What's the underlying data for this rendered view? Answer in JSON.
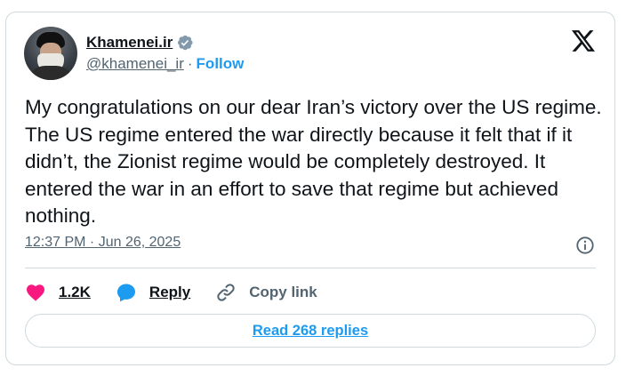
{
  "colors": {
    "accent": "#1d9bf0",
    "text_primary": "#0f1419",
    "text_secondary": "#536471",
    "border": "#cfd9de",
    "like": "#f91880"
  },
  "author": {
    "display_name": "Khamenei.ir",
    "handle": "@khamenei_ir",
    "separator": "·",
    "follow_label": "Follow",
    "verified_icon": "verified-badge-icon",
    "avatar": "profile-photo"
  },
  "tweet": {
    "text": "My congratulations on our dear Iran’s victory over the US regime. The US regime entered the war directly because it felt that if it didn’t, the Zionist regime would be completely destroyed. It entered the war in an effort to save that regime but achieved nothing.",
    "timestamp": "12:37 PM · Jun 26, 2025"
  },
  "actions": {
    "like_count": "1.2K",
    "reply_label": "Reply",
    "copy_link_label": "Copy link"
  },
  "footer": {
    "read_replies_label": "Read 268 replies"
  },
  "icons": {
    "brand": "x-logo-icon",
    "info": "info-icon",
    "like": "heart-icon",
    "reply": "speech-bubble-icon",
    "copy": "link-icon"
  }
}
